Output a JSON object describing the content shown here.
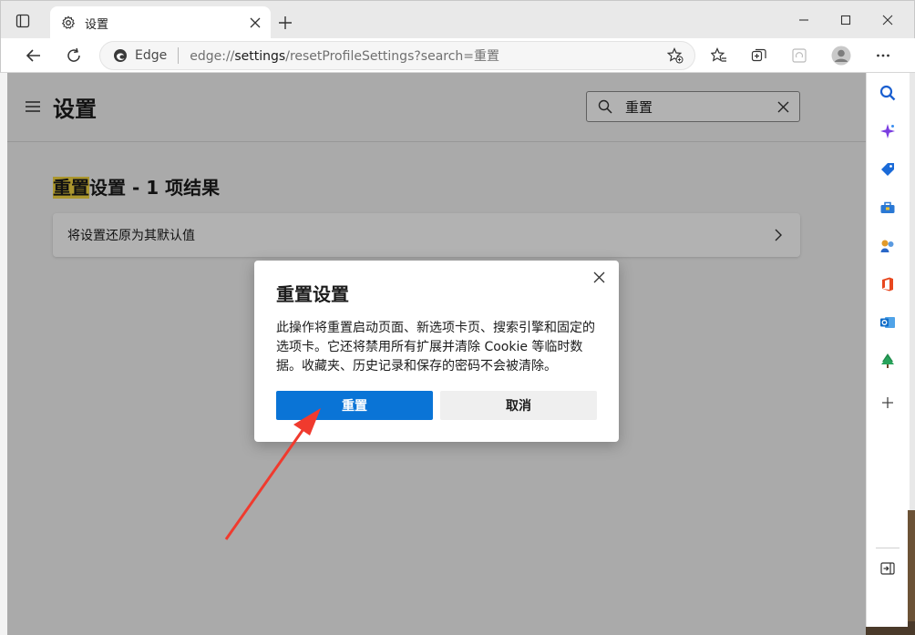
{
  "browser": {
    "tab_title": "设置",
    "omnibox_site": "Edge",
    "url_prefix": "edge://",
    "url_main": "settings",
    "url_rest": "/resetProfileSettings?search=重置"
  },
  "settings": {
    "page_title": "设置",
    "search_value": "重置",
    "heading_highlight": "重置",
    "heading_rest": "设置 - 1 项结果",
    "result_label": "将设置还原为其默认值"
  },
  "dialog": {
    "title": "重置设置",
    "body": "此操作将重置启动页面、新选项卡页、搜索引擎和固定的选项卡。它还将禁用所有扩展并清除 Cookie 等临时数据。收藏夹、历史记录和保存的密码不会被清除。",
    "confirm_label": "重置",
    "cancel_label": "取消"
  },
  "colors": {
    "accent": "#0a74d6",
    "highlight": "#f5d742",
    "annotation_arrow": "#f03a2e"
  }
}
